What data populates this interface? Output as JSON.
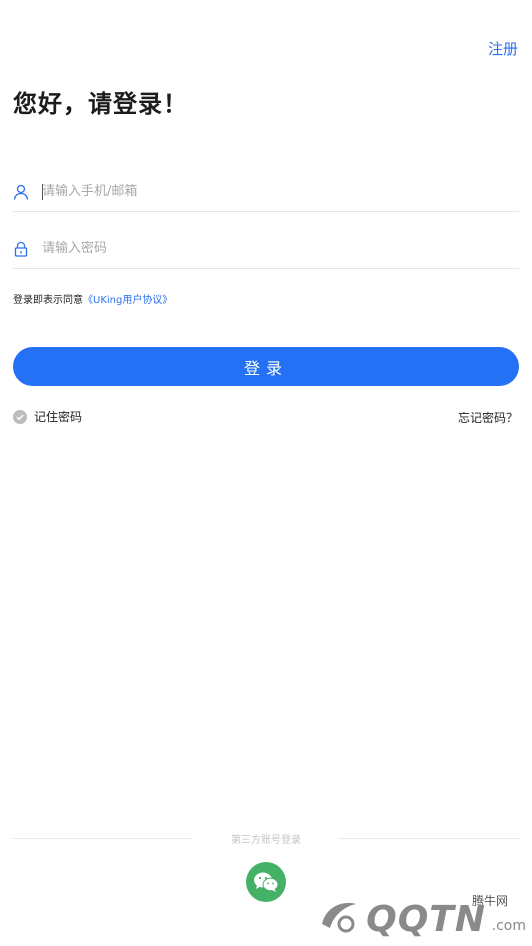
{
  "header": {
    "register_label": "注册"
  },
  "page": {
    "title": "您好，请登录！"
  },
  "form": {
    "phone_placeholder": "请输入手机/邮箱",
    "password_placeholder": "请输入密码",
    "agreement_prefix": "登录即表示同意",
    "agreement_link": "《UKing用户协议》",
    "login_label": "登录",
    "remember_label": "记住密码",
    "forgot_label": "忘记密码？"
  },
  "third_party": {
    "label": "第三方账号登录",
    "icons": [
      "wechat-icon"
    ]
  },
  "watermark": {
    "brand": "QQTN",
    "domain": ".com",
    "cn_name": "腾牛网"
  },
  "colors": {
    "accent": "#2471f5",
    "link": "#2a6ff0",
    "wechat": "#45b167"
  }
}
